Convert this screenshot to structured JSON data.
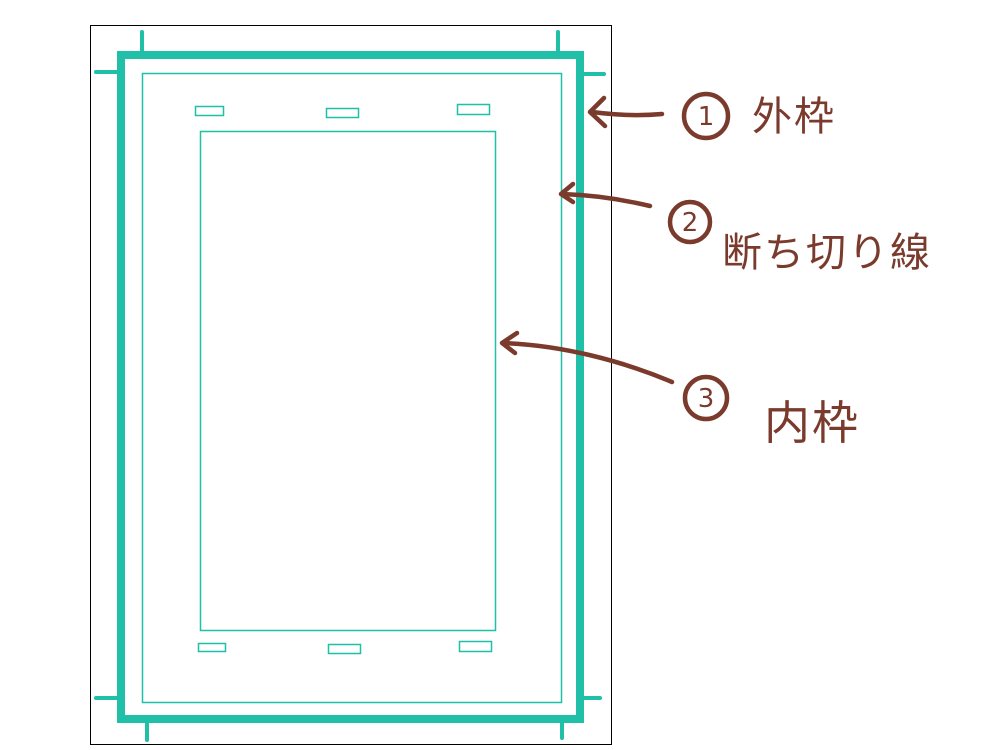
{
  "colors": {
    "frame": "#1fbfa8",
    "annotation": "#7a3a2c",
    "paper_border": "#000000",
    "background": "#ffffff"
  },
  "annotations": [
    {
      "number": "1",
      "text": "外枠"
    },
    {
      "number": "2",
      "text": "断ち切り線"
    },
    {
      "number": "3",
      "text": "内枠"
    }
  ]
}
